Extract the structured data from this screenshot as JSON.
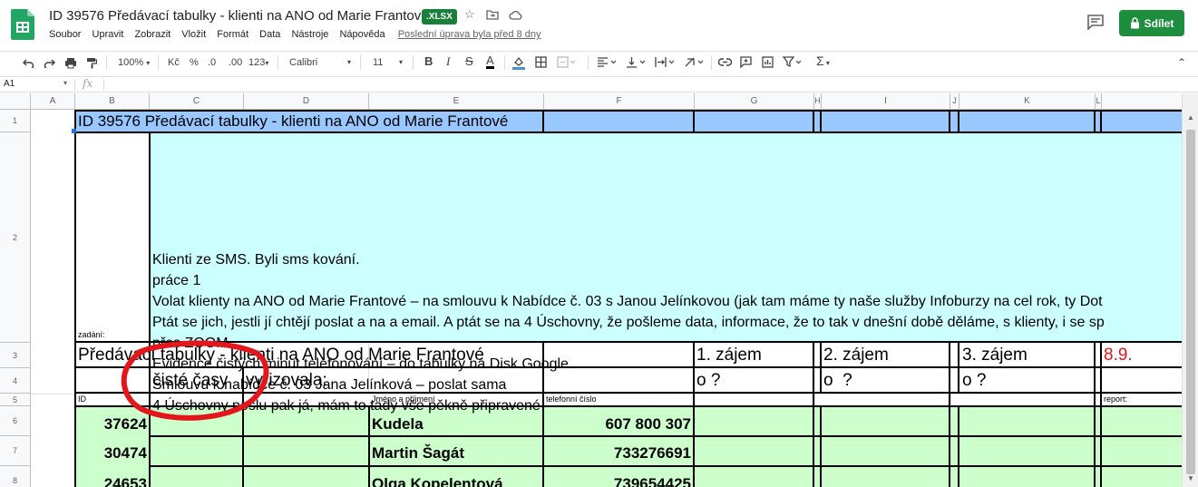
{
  "doc": {
    "title": "ID 39576 Předávací tabulky - klienti na ANO od Marie Frantové",
    "badge": ".XLSX",
    "share_label": "Sdílet",
    "last_edit": "Poslední úprava byla před 8 dny",
    "menu": [
      "Soubor",
      "Upravit",
      "Zobrazit",
      "Vložit",
      "Formát",
      "Data",
      "Nástroje",
      "Nápověda"
    ]
  },
  "toolbar": {
    "zoom": "100%",
    "currency": "Kč",
    "percent": "%",
    "dec_decrease": ".0",
    "dec_increase": ".00",
    "format_more": "123",
    "font": "Calibri",
    "font_size": "11",
    "bold": "B",
    "italic": "I",
    "strike": "S",
    "text_color": "A",
    "sum": "Σ"
  },
  "formula": {
    "cell_ref": "A1",
    "fx": "fx"
  },
  "columns": [
    "A",
    "B",
    "C",
    "D",
    "E",
    "F",
    "G",
    "H",
    "I",
    "J",
    "K",
    "L"
  ],
  "rows": [
    "1",
    "2",
    "3",
    "4",
    "5",
    "6",
    "7",
    "8"
  ],
  "cells": {
    "r1_title": "ID 39576 Předávací tabulky - klienti na ANO od Marie Frantové",
    "r2_label": "zadání:",
    "r2_lines": [
      "Klienti ze SMS. Byli sms kování.",
      "práce 1",
      "Volat klienty na ANO od Marie Frantové – na smlouvu k Nabídce č. 03 s Janou Jelínkovou (jak tam máme ty naše služby Infoburzy na cel rok, ty Dot",
      "Ptát se jich, jestli jí chtějí poslat a na a email. A ptát se na 4 Úschovny, že pošleme data, informace, že to tak v dnešní době děláme, s klienty, i se sp",
      "přes ZOOM.",
      "Evidence čistých minut telefonování – do tabulky na Disk Google",
      "Smlouvu k nabídce č. 03 Jana Jelínková – poslat sama",
      "4 Úschovny pošlu pak já, mám to tady vše pěkně připravené"
    ],
    "r3_title": "Předávací tabulky - klienti na ANO od Marie Frantové",
    "r3_zajem1": "1. zájem",
    "r3_zajem2": "2. zájem",
    "r3_zajem3": "3. zájem",
    "r3_date": "8.9.",
    "r4_ciste": "čisté časy",
    "r4_vyrizovala": "vyřizovala:",
    "r4_o1": "o ?",
    "r4_o2": "o  ?",
    "r4_o3": "o ?",
    "r5_id": "ID",
    "r5_name": "Jméno a příjmení",
    "r5_phone": "telefonní číslo",
    "r5_report": "report:",
    "data_rows": [
      {
        "id": "37624",
        "name": "Kudela",
        "phone": "607 800 307"
      },
      {
        "id": "30474",
        "name": "Martin Šagát",
        "phone": "733276691"
      },
      {
        "id": "24653",
        "name": "Olga Kopelentová",
        "phone": "739654425"
      }
    ]
  },
  "colors": {
    "header_blue": "#99c7ff",
    "task_cyan": "#ccffff",
    "data_green": "#ccffcc",
    "share_green": "#1e8e3e",
    "annotation_red": "#e3161b",
    "date_red": "#e3161b"
  }
}
